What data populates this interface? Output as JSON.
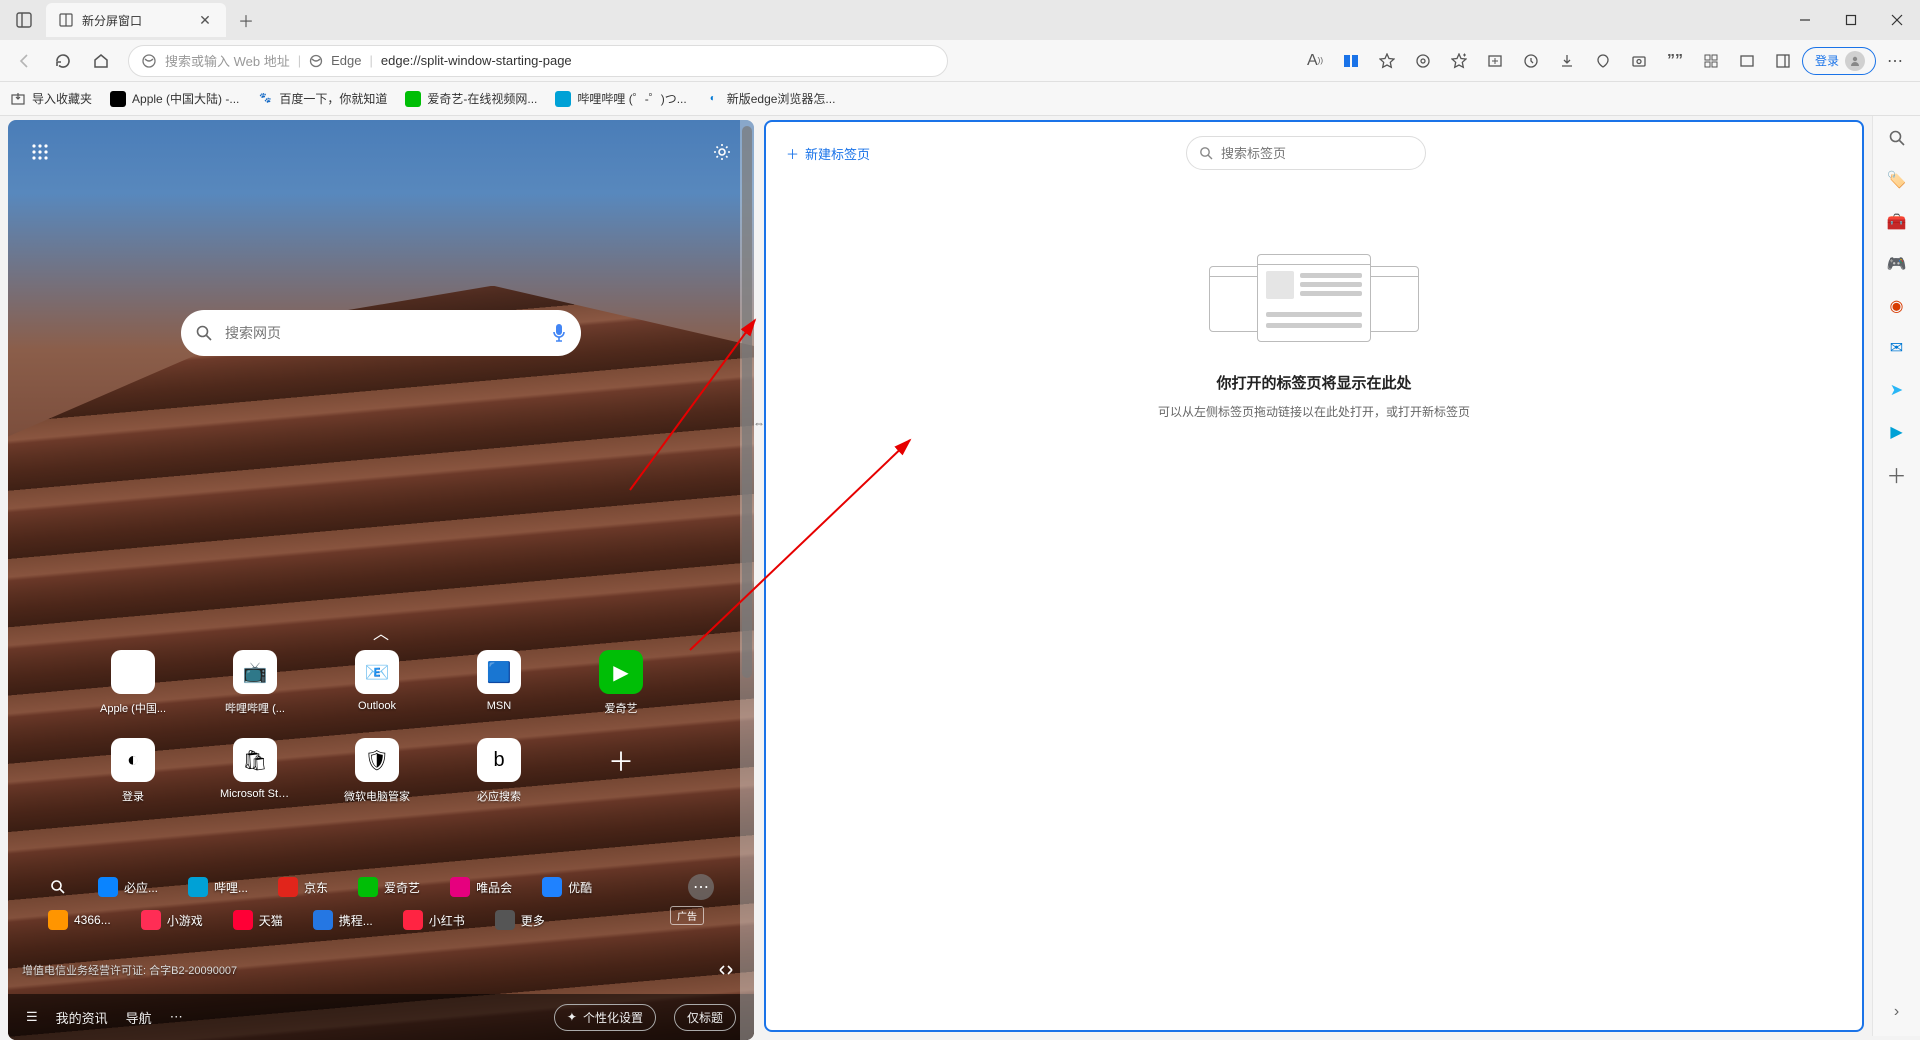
{
  "titlebar": {
    "tab_title": "新分屏窗口"
  },
  "toolbar": {
    "address_placeholder": "搜索或输入 Web 地址",
    "edge_label": "Edge",
    "url": "edge://split-window-starting-page",
    "login_label": "登录"
  },
  "bookmarks": {
    "import": "导入收藏夹",
    "items": [
      {
        "label": "Apple (中国大陆) -..."
      },
      {
        "label": "百度一下，你就知道"
      },
      {
        "label": "爱奇艺-在线视频网..."
      },
      {
        "label": "哔哩哔哩 (゜-゜)つ..."
      },
      {
        "label": "新版edge浏览器怎..."
      }
    ]
  },
  "ntp": {
    "search_placeholder": "搜索网页",
    "tiles_row1": [
      {
        "label": "Apple (中国..."
      },
      {
        "label": "哔哩哔哩 (..."
      },
      {
        "label": "Outlook"
      },
      {
        "label": "MSN"
      },
      {
        "label": "爱奇艺"
      }
    ],
    "tiles_row2": [
      {
        "label": "登录"
      },
      {
        "label": "Microsoft Sto..."
      },
      {
        "label": "微软电脑管家"
      },
      {
        "label": "必应搜索"
      }
    ],
    "quick_row1": [
      {
        "label": "必应...",
        "bg": "#0a84ff"
      },
      {
        "label": "哔哩...",
        "bg": "#00a1d6"
      },
      {
        "label": "京东",
        "bg": "#e1251b"
      },
      {
        "label": "爱奇艺",
        "bg": "#00be06"
      },
      {
        "label": "唯品会",
        "bg": "#e6007e"
      },
      {
        "label": "优酷",
        "bg": "#1f82ff"
      }
    ],
    "quick_row2": [
      {
        "label": "4366...",
        "bg": "#ff9500"
      },
      {
        "label": "小游戏",
        "bg": "#ff2d55"
      },
      {
        "label": "天猫",
        "bg": "#ff0036"
      },
      {
        "label": "携程...",
        "bg": "#2577e3"
      },
      {
        "label": "小红书",
        "bg": "#ff2442"
      },
      {
        "label": "更多",
        "bg": "#555"
      }
    ],
    "ad_label": "广告",
    "license": "增值电信业务经营许可证: 合字B2-20090007",
    "bottom": {
      "feed": "我的资讯",
      "nav": "导航",
      "personalize": "个性化设置",
      "title_only": "仅标题"
    }
  },
  "right_pane": {
    "new_tab": "新建标签页",
    "search_placeholder": "搜索标签页",
    "empty_title": "你打开的标签页将显示在此处",
    "empty_sub": "可以从左侧标签页拖动链接以在此处打开，或打开新标签页"
  }
}
